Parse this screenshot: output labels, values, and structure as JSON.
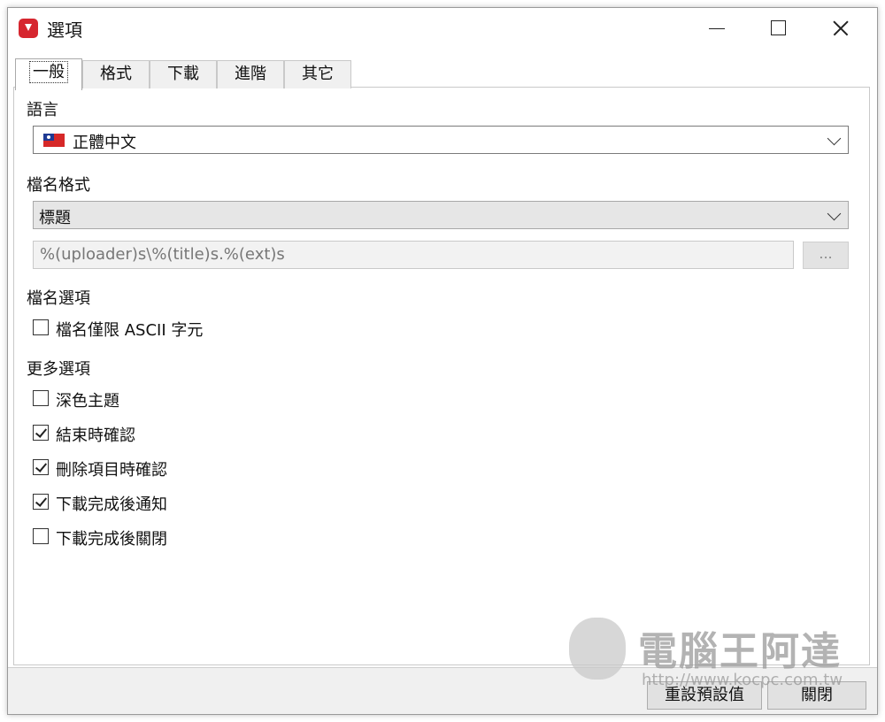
{
  "window": {
    "title": "選項"
  },
  "tabs": [
    {
      "label": "一般"
    },
    {
      "label": "格式"
    },
    {
      "label": "下載"
    },
    {
      "label": "進階"
    },
    {
      "label": "其它"
    }
  ],
  "general": {
    "language_label": "語言",
    "language_value": "正體中文",
    "language_flag": "taiwan-flag-icon",
    "filename_format_label": "檔名格式",
    "filename_format_value": "標題",
    "filename_template": "%(uploader)s\\%(title)s.%(ext)s",
    "browse_label": "...",
    "filename_options_label": "檔名選項",
    "filename_options": [
      {
        "label": "檔名僅限 ASCII 字元",
        "checked": false
      }
    ],
    "more_options_label": "更多選項",
    "more_options": [
      {
        "label": "深色主題",
        "checked": false
      },
      {
        "label": "結束時確認",
        "checked": true
      },
      {
        "label": "刪除項目時確認",
        "checked": true
      },
      {
        "label": "下載完成後通知",
        "checked": true
      },
      {
        "label": "下載完成後關閉",
        "checked": false
      }
    ]
  },
  "footer": {
    "reset_label": "重設預設值",
    "close_label": "關閉"
  },
  "watermark": {
    "text": "電腦王阿達",
    "url": "http://www.kocpc.com.tw"
  },
  "colors": {
    "app_icon": "#d6262f",
    "dialog_bg": "#f0f0f0"
  }
}
